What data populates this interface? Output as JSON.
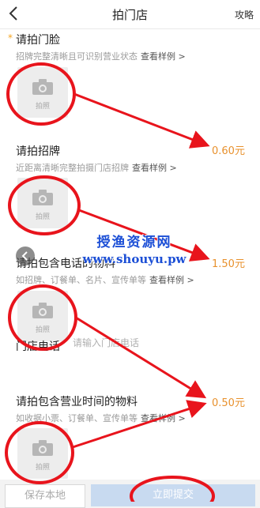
{
  "nav": {
    "title": "拍门店",
    "right": "攻略",
    "back_icon": "chevron-left-icon"
  },
  "sections": [
    {
      "title": "请拍门脸",
      "required_mark": "*",
      "subtitle": "招牌完整清晰且可识别营业状态",
      "example": "查看样例 >",
      "photo_label": "拍照"
    },
    {
      "title": "请拍招牌",
      "subtitle": "近距离清晰完整拍摄门店招牌",
      "example": "查看样例 >",
      "price": "0.60元",
      "photo_label": "拍照"
    },
    {
      "title": "请拍包含电话的物料",
      "subtitle": "如招牌、订餐单、名片、宣传单等",
      "example": "查看样例 >",
      "price": "1.50元",
      "photo_label": "拍照"
    },
    {
      "title": "请拍包含营业时间的物料",
      "subtitle": "如收据小票、订餐单、宣传单等",
      "example": "查看样例 >",
      "price": "0.50元",
      "photo_label": "拍照"
    }
  ],
  "phone": {
    "label": "门店电话",
    "placeholder": "请输入门店电话"
  },
  "photo_extra": {
    "label": "拍照"
  },
  "watermark": {
    "line1": "授渔资源网",
    "line2": "www.shouyu.pw"
  },
  "buttons": {
    "save": "保存本地",
    "submit": "立即提交"
  },
  "colors": {
    "accent": "#e8912d",
    "annotation": "#e8141c",
    "watermark": "#1c4fd6",
    "submit_bg": "#c8daf0"
  }
}
